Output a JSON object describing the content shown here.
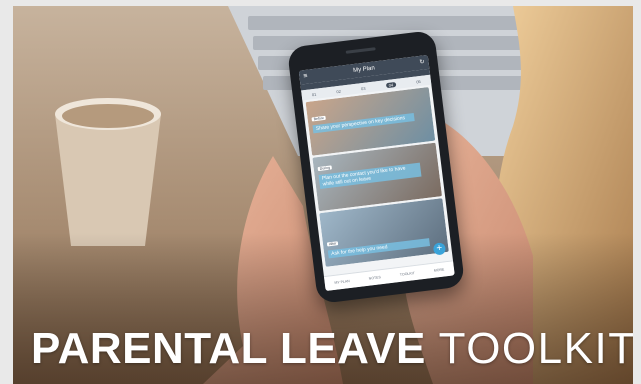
{
  "banner": {
    "title_bold": "PARENTAL LEAVE",
    "title_light": "TOOLKIT"
  },
  "app": {
    "header_title": "My Plan",
    "menu_icon": "menu-icon",
    "tabs": [
      "01",
      "02",
      "03",
      "04",
      "05"
    ],
    "cards": [
      {
        "tag": "Before",
        "caption": "Share your perspective on key decisions"
      },
      {
        "tag": "During",
        "caption": "Plan out the contact you'd like to have while still out on leave"
      },
      {
        "tag": "After",
        "caption": "Ask for the help you need"
      }
    ],
    "nav": [
      "MY PLAN",
      "NOTES",
      "TOOLKIT",
      "MORE"
    ]
  }
}
